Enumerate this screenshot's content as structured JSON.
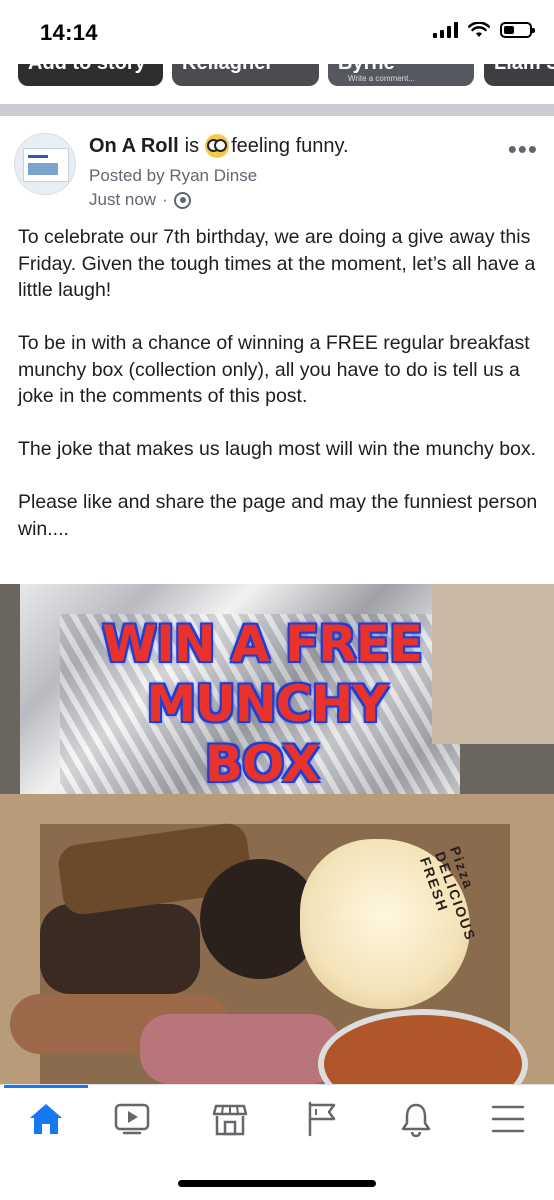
{
  "status_bar": {
    "time": "14:14"
  },
  "stories": [
    {
      "label": "Add to story"
    },
    {
      "label": "Kellagher"
    },
    {
      "label": "Byrne",
      "sub": "Write a comment..."
    },
    {
      "label": "Liam Sl"
    }
  ],
  "post": {
    "page_name": "On A Roll",
    "verb": "is",
    "feeling": "feeling funny.",
    "posted_by": "Posted by Ryan Dinse",
    "time": "Just now",
    "separator": "·",
    "more": "•••",
    "paragraphs": [
      "To celebrate our 7th birthday, we are doing a give away this Friday. Given the tough times at the moment, let’s all have a little laugh!",
      "To be in with a chance of winning a FREE regular breakfast munchy box (collection only), all you have to do is tell us a joke in the comments of this post.",
      "The joke that makes us laugh most will win the munchy box.",
      "Please like and share the page and may the funniest person win...."
    ],
    "image": {
      "promo_lines": [
        "WIN A FREE",
        "MUNCHY",
        "BOX"
      ],
      "box_print": "Pizza  DELICIOUS FRESH"
    }
  },
  "tabbar": {
    "items": [
      {
        "icon": "home-icon",
        "active": true
      },
      {
        "icon": "watch-icon",
        "active": false
      },
      {
        "icon": "marketplace-icon",
        "active": false
      },
      {
        "icon": "pages-flag-icon",
        "active": false
      },
      {
        "icon": "notifications-bell-icon",
        "active": false
      },
      {
        "icon": "menu-icon",
        "active": false
      }
    ],
    "accent": "#1877f2"
  }
}
